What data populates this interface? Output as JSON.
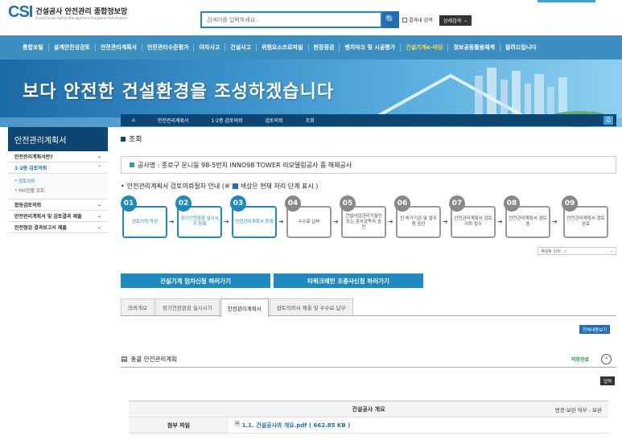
{
  "header": {
    "logo_mark": "CSI",
    "logo_title": "건설공사 안전관리 종합정보망",
    "logo_sub": "Construction Safety Management Integrated Information",
    "search_placeholder": "검색어를 입력하세요.",
    "search_icon": "search-icon",
    "result_check_label": "결과내 검색",
    "advanced_label": "상세검색"
  },
  "nav": {
    "items": [
      "통합포털",
      "설계안전성검토",
      "안전관리계획서",
      "안전관리수준평가",
      "야차사고",
      "건설사고",
      "위험요소프로파일",
      "현장점검",
      "벤치마크 및 시공평가",
      "건설기계e-마당",
      "정보공동활용체계",
      "알려드립니다"
    ],
    "highlight_index": 9
  },
  "banner": {
    "text": "보다 안전한 건설환경을 조성하겠습니다"
  },
  "breadcrumb": {
    "home": "⌂",
    "items": [
      "안전관리계획서",
      "1·2종 검토의뢰",
      "검토의뢰",
      "조회"
    ]
  },
  "sidebar": {
    "title": "안전관리계획서",
    "items": [
      {
        "label": "안전관리계획서란?",
        "active": false
      },
      {
        "label": "1·2종 검토의뢰",
        "active": true
      }
    ],
    "sub_items": [
      "검토의뢰",
      "처리현황 조회"
    ],
    "items2": [
      {
        "label": "합동검토의뢰"
      },
      {
        "label": "안전관리계획서 및 검토결과 제출"
      },
      {
        "label": "안전점검 결과보고서 제출"
      }
    ]
  },
  "main": {
    "title": "조회",
    "project": "공사명 : 종로구 운니동 98-5번지 INNO98 TOWER 리모델링공사 중 해체공사",
    "guide_prefix": "안전관리계획서 검토의뢰절차 안내 (※",
    "guide_suffix": "색상은 현재 처리 단계 표시 )",
    "steps": [
      {
        "num": "01",
        "label": "검토의뢰 작성",
        "state": "on"
      },
      {
        "num": "02",
        "label": "정기안전점검 실시시기 등록",
        "state": "on"
      },
      {
        "num": "03",
        "label": "안전관리계획서 등록",
        "state": "on"
      },
      {
        "num": "04",
        "label": "수수료 납부",
        "state": "off"
      },
      {
        "num": "05",
        "label": "건설사업관리기술인 또는 공사감독자 승인",
        "state": "off"
      },
      {
        "num": "06",
        "label": "인·허가기관 및 발주청 승인",
        "state": "off"
      },
      {
        "num": "07",
        "label": "안전관리계획서 검토의뢰 접수",
        "state": "off"
      },
      {
        "num": "08",
        "label": "안전관리계획서 검토중",
        "state": "off"
      },
      {
        "num": "09",
        "label": "안전관리계획서 검토완료",
        "state": "off"
      }
    ],
    "revision_select": "재검토 1차(...)",
    "btn_machine": "건설기계 임차신청 하러가기",
    "btn_crane": "타워크레인 조종사신청 하러가기",
    "tabs": [
      "의뢰개요",
      "정기안전점검 실시시기",
      "안전관리계획서",
      "검토의뢰서 제출 및 수수료 납부"
    ],
    "active_tab": 2,
    "view_all": "전체내용보기",
    "section_title": "총괄 안전관리계획",
    "saved_label": "저장완료",
    "input_btn": "입력",
    "table": {
      "head": "건설공사 개요",
      "head_right": "변경·보완 여부 :  보완",
      "row_label": "첨부 파일",
      "file": "1.1. 건설공사의 개요.pdf ( 662.85 KB )"
    }
  }
}
